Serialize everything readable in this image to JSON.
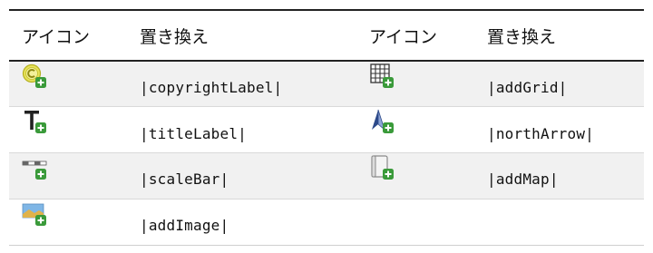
{
  "header": {
    "col1": "アイコン",
    "col2": "置き換え",
    "col3": "アイコン",
    "col4": "置き換え"
  },
  "rows": [
    {
      "left": {
        "icon": "copyright-label-add-icon",
        "text": "|copyrightLabel|"
      },
      "right": {
        "icon": "add-grid-icon",
        "text": "|addGrid|"
      }
    },
    {
      "left": {
        "icon": "title-label-add-icon",
        "text": "|titleLabel|"
      },
      "right": {
        "icon": "north-arrow-add-icon",
        "text": "|northArrow|"
      }
    },
    {
      "left": {
        "icon": "scale-bar-add-icon",
        "text": "|scaleBar|"
      },
      "right": {
        "icon": "add-map-icon",
        "text": "|addMap|"
      }
    },
    {
      "left": {
        "icon": "add-image-icon",
        "text": "|addImage|"
      },
      "right": {
        "icon": "",
        "text": ""
      }
    }
  ],
  "colors": {
    "plus_badge": "#3a9a3a",
    "copyright_yellow": "#d8d43a",
    "stripe": "#f1f1f1"
  }
}
